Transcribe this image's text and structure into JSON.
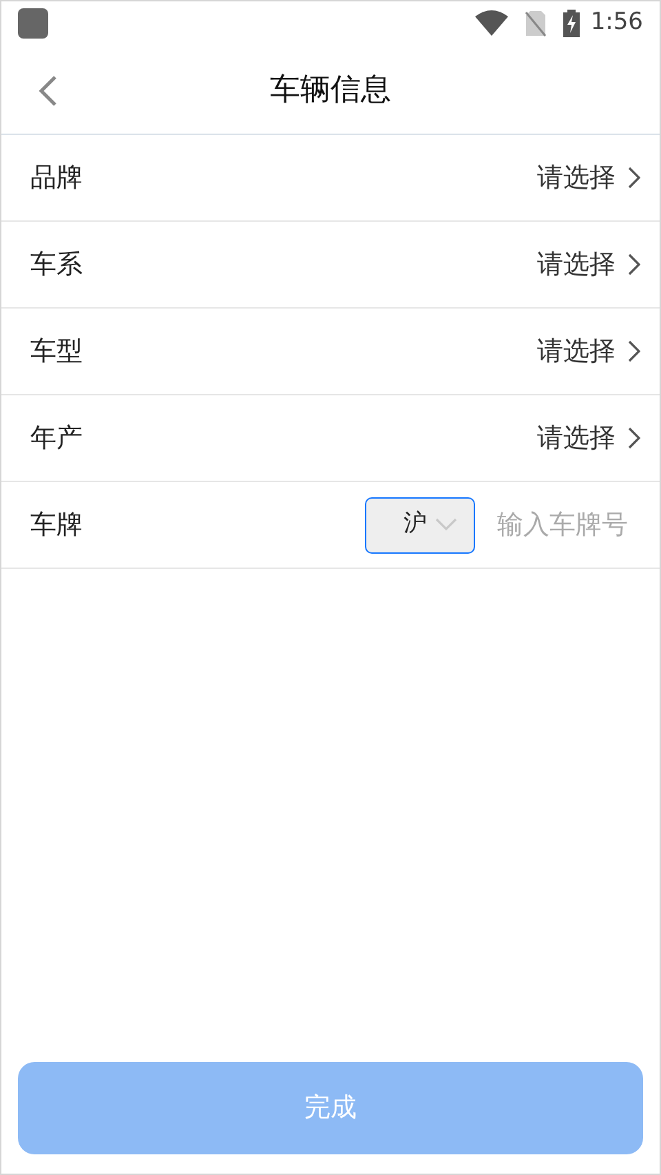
{
  "status_bar": {
    "time": "1:56"
  },
  "header": {
    "title": "车辆信息"
  },
  "rows": [
    {
      "kind": "select",
      "label": "品牌",
      "value": "请选择"
    },
    {
      "kind": "select",
      "label": "车系",
      "value": "请选择"
    },
    {
      "kind": "select",
      "label": "车型",
      "value": "请选择"
    },
    {
      "kind": "select",
      "label": "年产",
      "value": "请选择"
    },
    {
      "kind": "plate",
      "label": "车牌",
      "region": "沪",
      "placeholder": "输入车牌号"
    }
  ],
  "submit": {
    "label": "完成",
    "disabled": true
  }
}
